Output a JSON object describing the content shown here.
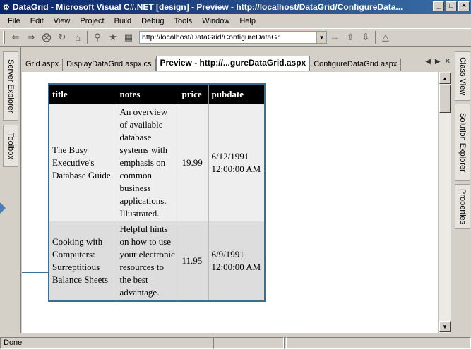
{
  "window": {
    "title": "DataGrid - Microsoft Visual C#.NET [design] - Preview - http://localhost/DataGrid/ConfigureData...",
    "buttons": [
      "_",
      "□",
      "×"
    ]
  },
  "menu": {
    "items": [
      "File",
      "Edit",
      "View",
      "Project",
      "Build",
      "Debug",
      "Tools",
      "Window",
      "Help"
    ]
  },
  "toolbar": {
    "url": "http://localhost/DataGrid/ConfigureDataGr"
  },
  "left_panel": {
    "tabs": [
      "Server Explorer",
      "Toolbox"
    ]
  },
  "right_panel": {
    "tabs": [
      "Class View",
      "Solution Explorer",
      "Properties"
    ]
  },
  "doc_tabs": {
    "items": [
      "Grid.aspx",
      "DisplayDataGrid.aspx.cs",
      "Preview - http://...gureDataGrid.aspx",
      "ConfigureDataGrid.aspx"
    ],
    "active_index": 2
  },
  "grid": {
    "columns": [
      "title",
      "notes",
      "price",
      "pubdate"
    ],
    "rows": [
      {
        "title": "The Busy Executive's Database Guide",
        "notes": "An overview of available database systems with emphasis on common business applications. Illustrated.",
        "price": "19.99",
        "pubdate": "6/12/1991 12:00:00 AM"
      },
      {
        "title": "Cooking with Computers: Surreptitious Balance Sheets",
        "notes": "Helpful hints on how to use your electronic resources to the best advantage.",
        "price": "11.95",
        "pubdate": "6/9/1991 12:00:00 AM"
      }
    ]
  },
  "status": {
    "text": "Done"
  }
}
